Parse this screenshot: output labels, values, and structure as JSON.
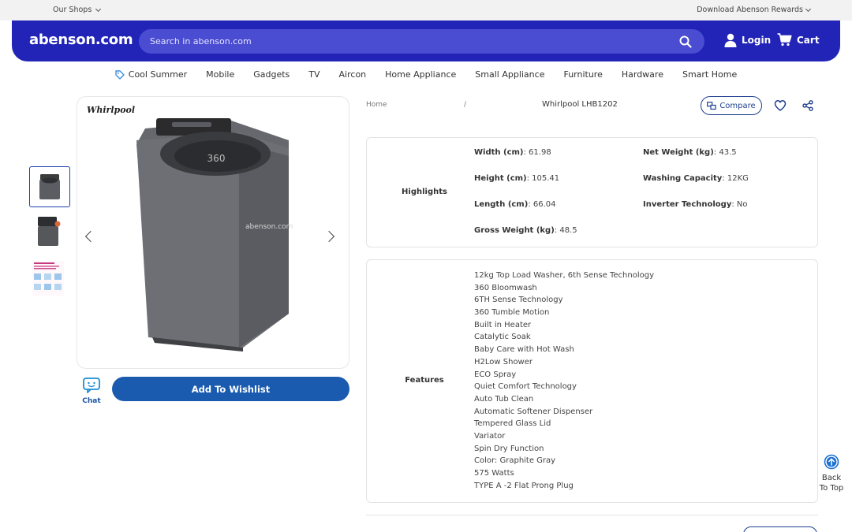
{
  "topbar": {
    "shops_label": "Our Shops",
    "rewards_label": "Download Abenson Rewards"
  },
  "header": {
    "logo": "abenson.com",
    "search_placeholder": "Search in abenson.com",
    "login_label": "Login",
    "cart_label": "Cart",
    "bg_color": "#2224b8"
  },
  "nav": {
    "items": [
      "Cool Summer",
      "Mobile",
      "Gadgets",
      "TV",
      "Aircon",
      "Home Appliance",
      "Small Appliance",
      "Furniture",
      "Hardware",
      "Smart Home"
    ]
  },
  "gallery": {
    "brand_logo": "Whirlpool",
    "watermark": "abenson.com",
    "drum_label": "360"
  },
  "actions": {
    "chat_label": "Chat",
    "wishlist_label": "Add To Wishlist"
  },
  "breadcrumb": {
    "home": "Home",
    "separator": "/",
    "current": "Whirlpool LHB1202"
  },
  "toolbar": {
    "compare_label": "Compare"
  },
  "highlights": {
    "label": "Highlights",
    "specs": [
      {
        "name": "Width (cm)",
        "value": ": 61.98"
      },
      {
        "name": "Net Weight (kg)",
        "value": ": 43.5"
      },
      {
        "name": "Height (cm)",
        "value": ": 105.41"
      },
      {
        "name": "Washing Capacity",
        "value": ": 12KG"
      },
      {
        "name": "Length (cm)",
        "value": ": 66.04"
      },
      {
        "name": "Inverter Technology",
        "value": ": No"
      },
      {
        "name": "Gross Weight (kg)",
        "value": ": 48.5"
      }
    ]
  },
  "features": {
    "label": "Features",
    "items": [
      "12kg Top Load Washer, 6th Sense Technology",
      "360 Bloomwash",
      "6TH Sense Technology",
      "360 Tumble Motion",
      "Built in Heater",
      "Catalytic Soak",
      "Baby Care with Hot Wash",
      "H2Low Shower",
      "ECO Spray",
      "Quiet Comfort Technology",
      "Auto Tub Clean",
      "Automatic Softener Dispenser",
      "Tempered Glass Lid",
      "Variator",
      "Spin Dry Function",
      "Color: Graphite Gray",
      "575 Watts",
      "TYPE A -2 Flat Prong Plug"
    ]
  },
  "back_to_top": {
    "line1": "Back",
    "line2": "To Top"
  }
}
